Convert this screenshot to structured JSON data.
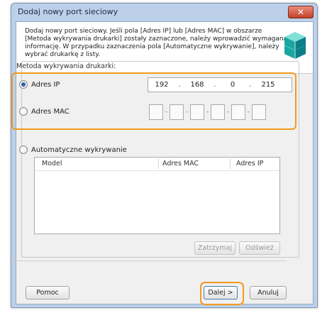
{
  "window": {
    "title": "Dodaj nowy port sieciowy",
    "close_symbol": "✕"
  },
  "intro": {
    "description": "Dodaj nowy port sieciowy. Jeśli pola [Adres IP] lub [Adres MAC] w obszarze [Metoda wykrywania drukarki] zostały zaznaczone, należy wprowadzić wymaganą informację. W przypadku zaznaczenia pola [Automatyczne wykrywanie], należy wybrać drukarkę z listy.",
    "icon": "printer-cube-icon"
  },
  "detection": {
    "group_label": "Metoda wykrywania drukarki:",
    "ip_option": {
      "label": "Adres IP",
      "selected": true
    },
    "ip_address": [
      "192",
      "168",
      "0",
      "215"
    ],
    "ip_separator": ".",
    "mac_option": {
      "label": "Adres MAC",
      "selected": false
    },
    "mac_separator": "-",
    "auto_option": {
      "label": "Automatyczne wykrywanie",
      "selected": false
    }
  },
  "table": {
    "columns": [
      "Model",
      "Adres MAC",
      "Adres IP"
    ],
    "rows": []
  },
  "buttons": {
    "stop": "Zatrzymaj",
    "refresh": "Odśwież",
    "help": "Pomoc",
    "next": "Dalej >",
    "cancel": "Anuluj"
  },
  "colors": {
    "highlight": "#f29a1d",
    "radio_dot": "#2c5fa8",
    "title_bar": "#bcd0ea"
  }
}
